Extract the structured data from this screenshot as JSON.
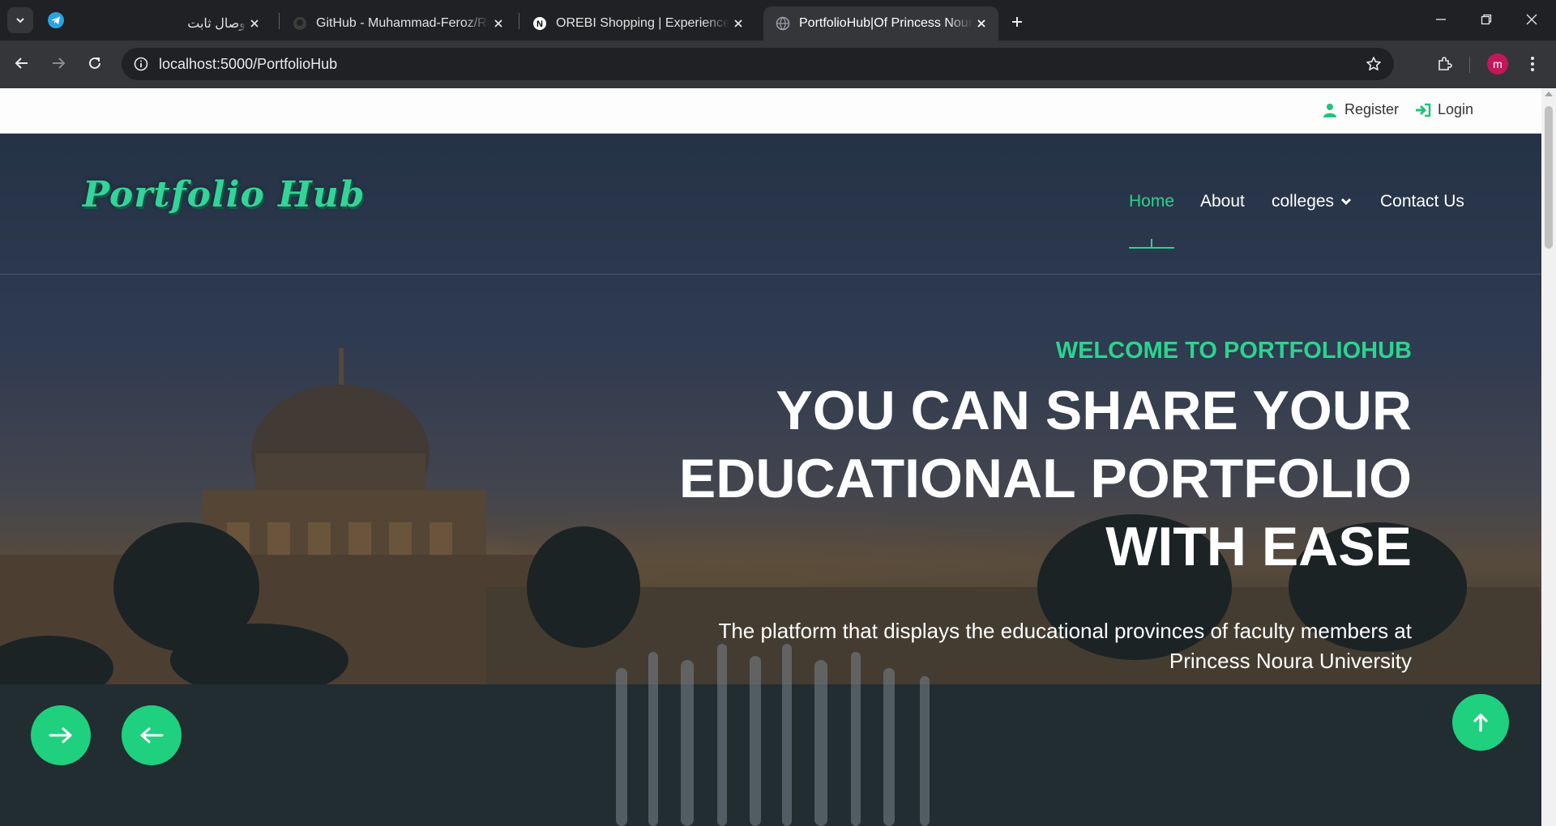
{
  "browser": {
    "tabs": [
      {
        "title": "وصال ثابت",
        "favicon": "telegram-icon"
      },
      {
        "title": "GitHub - Muhammad-Feroz/Re",
        "favicon": "github-icon"
      },
      {
        "title": "OREBI Shopping | Experience th",
        "favicon": "notion-icon"
      },
      {
        "title": "PortfolioHub|Of Princess Noura",
        "favicon": "globe-icon",
        "active": true
      }
    ],
    "url": "localhost:5000/PortfolioHub",
    "profile_initial": "m"
  },
  "topbar": {
    "register_label": "Register",
    "login_label": "Login"
  },
  "header": {
    "logo_text": "Portfolio Hub",
    "nav": [
      {
        "label": "Home",
        "active": true
      },
      {
        "label": "About"
      },
      {
        "label": "colleges",
        "has_dropdown": true
      },
      {
        "label": "Contact Us"
      }
    ]
  },
  "hero": {
    "welcome": "WELCOME TO PORTFOLIOHUB",
    "headline_line1": "YOU CAN SHARE YOUR",
    "headline_line2": "EDUCATIONAL PORTFOLIO",
    "headline_line3": "WITH EASE",
    "subtext_line1": "The platform that displays the educational provinces of faculty members at",
    "subtext_line2": "Princess Noura University"
  },
  "colors": {
    "accent": "#2bd48f",
    "button": "#1fd07f"
  }
}
